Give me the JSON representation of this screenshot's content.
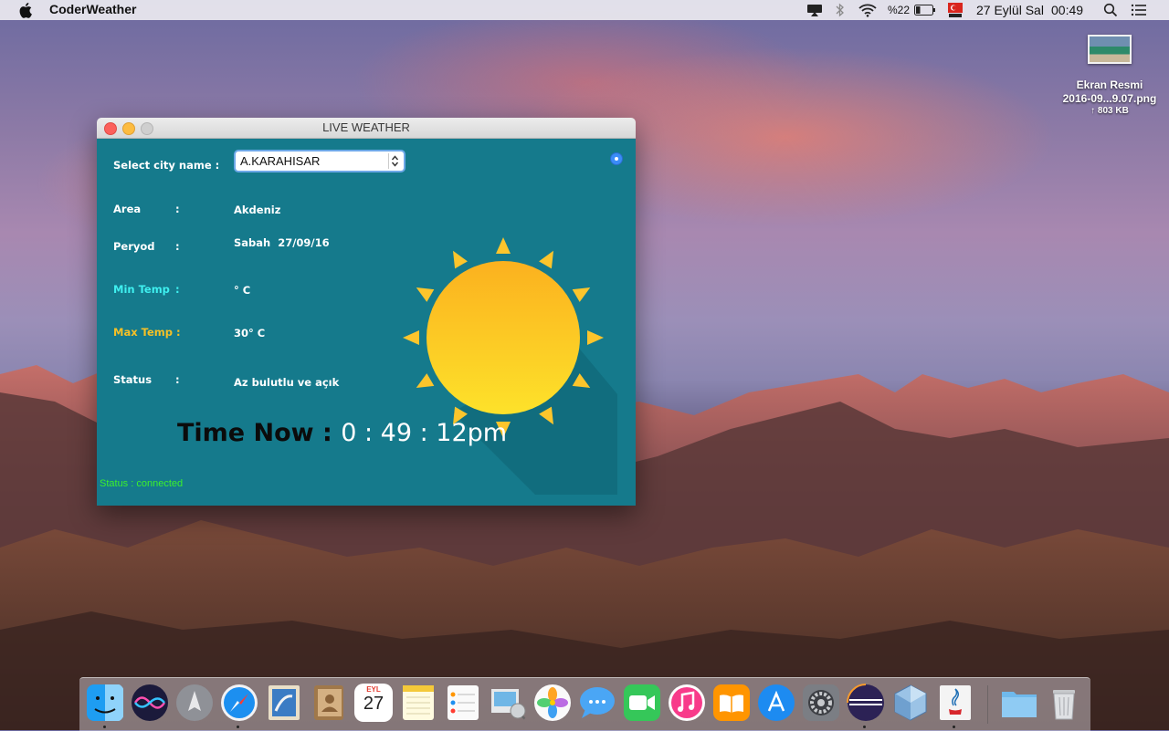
{
  "menubar": {
    "app_name": "CoderWeather",
    "battery": "%22",
    "date": "27 Eylül Sal",
    "time": "00:49"
  },
  "desktop_file": {
    "name_line1": "Ekran Resmi",
    "name_line2": "2016-09...9.07.png",
    "size": "↑ 803 KB"
  },
  "window": {
    "title": "LIVE WEATHER",
    "select_label": "Select city name :",
    "selected_city": "A.KARAHISAR",
    "fields": {
      "area_label": "Area",
      "area_value": "Akdeniz",
      "period_label": "Peryod",
      "period_value": "Sabah  27/09/16",
      "min_label": "Min Temp",
      "min_value": "° C",
      "max_label": "Max Temp :",
      "max_value": "30° C",
      "status_label": "Status",
      "status_value": "Az bulutlu ve açık",
      "colon": ":"
    },
    "time_label": "Time Now :",
    "time_value": "0 : 49 : 12pm",
    "status_bar": "Status : connected",
    "colors": {
      "panel": "#157a8c",
      "min_label": "#3ff0f0",
      "max_label": "#f5c026",
      "status_ok": "#3cf02d"
    }
  },
  "dock": {
    "items": [
      {
        "name": "Finder"
      },
      {
        "name": "Siri"
      },
      {
        "name": "Launchpad"
      },
      {
        "name": "Safari"
      },
      {
        "name": "Mail"
      },
      {
        "name": "Contacts"
      },
      {
        "name": "Calendar",
        "month": "EYL",
        "day": "27"
      },
      {
        "name": "Notes"
      },
      {
        "name": "Reminders"
      },
      {
        "name": "Preview"
      },
      {
        "name": "Photos"
      },
      {
        "name": "Messages"
      },
      {
        "name": "FaceTime"
      },
      {
        "name": "iTunes"
      },
      {
        "name": "iBooks"
      },
      {
        "name": "App Store"
      },
      {
        "name": "System Preferences"
      },
      {
        "name": "Eclipse"
      },
      {
        "name": "VirtualBox"
      },
      {
        "name": "Java"
      },
      {
        "name": "Downloads"
      },
      {
        "name": "Trash"
      }
    ]
  }
}
